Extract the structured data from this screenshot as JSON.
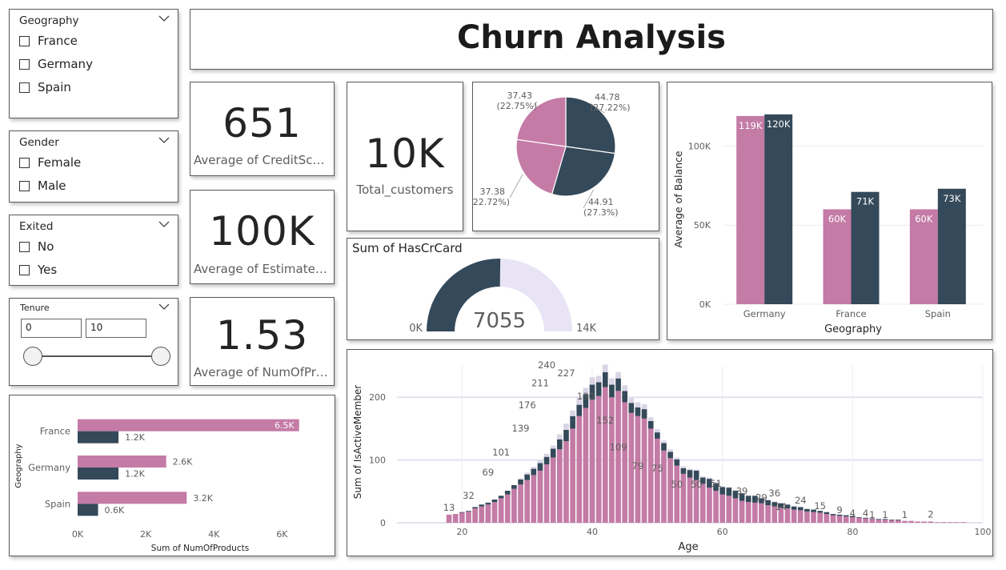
{
  "title": "Churn Analysis",
  "colors": {
    "pink": "#c47ba6",
    "navy": "#34495a",
    "light": "#e8e4f5",
    "grid": "#ececec"
  },
  "slicers": {
    "geography": {
      "title": "Geography",
      "options": [
        "France",
        "Germany",
        "Spain"
      ]
    },
    "gender": {
      "title": "Gender",
      "options": [
        "Female",
        "Male"
      ]
    },
    "exited": {
      "title": "Exited",
      "options": [
        "No",
        "Yes"
      ]
    },
    "tenure": {
      "title": "Tenure",
      "min": "0",
      "max": "10"
    }
  },
  "kpis": {
    "credit": {
      "value": "651",
      "label": "Average of CreditScore"
    },
    "salary": {
      "value": "100K",
      "label": "Average of Estimated..."
    },
    "products": {
      "value": "1.53",
      "label": "Average of NumOfPro..."
    },
    "customers": {
      "value": "10K",
      "label": "Total_customers"
    }
  },
  "gauge": {
    "title": "Sum of HasCrCard",
    "value_label": "7055",
    "min_label": "0K",
    "max_label": "14K",
    "value": 7055,
    "max": 14000
  },
  "chart_data": [
    {
      "type": "pie",
      "slices": [
        {
          "value": 44.78,
          "label": "44.78",
          "pct": "(27.22%)",
          "color": "navy"
        },
        {
          "value": 44.91,
          "label": "44.91",
          "pct": "(27.3%)",
          "color": "navy"
        },
        {
          "value": 37.38,
          "label": "37.38",
          "pct": "(22.72%)",
          "color": "pink"
        },
        {
          "value": 37.43,
          "label": "37.43",
          "pct": "(22.75%)",
          "color": "pink"
        }
      ]
    },
    {
      "type": "bar",
      "categories": [
        "Germany",
        "France",
        "Spain"
      ],
      "series": [
        {
          "values": [
            119000,
            60000,
            60000
          ],
          "labels": [
            "119K",
            "60K",
            "60K"
          ]
        },
        {
          "values": [
            120000,
            71000,
            73000
          ],
          "labels": [
            "120K",
            "71K",
            "73K"
          ]
        }
      ],
      "xlabel": "Geography",
      "ylabel": "Average of Balance",
      "yticks": [
        0,
        50000,
        100000
      ],
      "ytick_labels": [
        "0K",
        "50K",
        "100K"
      ],
      "ylim": [
        0,
        125000
      ]
    },
    {
      "type": "bar",
      "orientation": "horizontal",
      "categories": [
        "France",
        "Germany",
        "Spain"
      ],
      "series": [
        {
          "values": [
            6500,
            2600,
            3200
          ],
          "labels": [
            "6.5K",
            "2.6K",
            "3.2K"
          ]
        },
        {
          "values": [
            1200,
            1200,
            600
          ],
          "labels": [
            "1.2K",
            "1.2K",
            "0.6K"
          ]
        }
      ],
      "xlabel": "Sum of NumOfProducts",
      "ylabel": "Geography",
      "xticks": [
        0,
        2000,
        4000,
        6000
      ],
      "xtick_labels": [
        "0K",
        "2K",
        "4K",
        "6K"
      ],
      "xlim": [
        0,
        7000
      ]
    },
    {
      "type": "bar",
      "xlabel": "Age",
      "ylabel": "Sum of IsActiveMember",
      "xlim": [
        10,
        100
      ],
      "ylim": [
        0,
        250
      ],
      "xticks": [
        20,
        40,
        60,
        80,
        100
      ],
      "yticks": [
        0,
        100,
        200
      ],
      "pink": [
        13,
        14,
        16,
        18,
        23,
        26,
        29,
        33,
        39,
        45,
        54,
        61,
        68,
        76,
        83,
        93,
        104,
        117,
        130,
        150,
        170,
        183,
        196,
        202,
        216,
        200,
        210,
        192,
        175,
        170,
        166,
        150,
        134,
        115,
        103,
        91,
        78,
        72,
        68,
        62,
        56,
        51,
        45,
        43,
        39,
        35,
        33,
        32,
        31,
        28,
        26,
        24,
        23,
        21,
        20,
        18,
        17,
        16,
        14,
        12,
        11,
        10,
        9,
        8,
        7,
        6,
        5,
        5,
        4,
        4,
        3,
        3,
        2,
        2,
        2,
        1,
        1,
        1,
        1,
        1
      ],
      "navy": [
        0,
        0,
        1,
        1,
        2,
        3,
        3,
        4,
        4,
        6,
        6,
        8,
        9,
        10,
        12,
        12,
        14,
        16,
        18,
        20,
        18,
        22,
        24,
        22,
        24,
        20,
        20,
        18,
        16,
        14,
        15,
        12,
        10,
        12,
        10,
        10,
        9,
        12,
        15,
        10,
        14,
        12,
        12,
        13,
        12,
        12,
        10,
        11,
        8,
        8,
        7,
        7,
        6,
        5,
        5,
        4,
        4,
        3,
        3,
        2,
        2,
        2,
        2,
        1,
        1,
        1,
        1,
        1,
        1,
        1,
        0,
        0,
        0,
        0,
        0,
        0,
        0,
        0,
        0,
        0
      ],
      "light": [
        0,
        0,
        0,
        0,
        0,
        0,
        0,
        0,
        0,
        0,
        0,
        2,
        3,
        3,
        4,
        5,
        5,
        8,
        10,
        9,
        12,
        10,
        12,
        10,
        12,
        10,
        10,
        9,
        8,
        8,
        8,
        6,
        5,
        4,
        4,
        3,
        3,
        2,
        2,
        2,
        2,
        2,
        1,
        1,
        1,
        1,
        1,
        1,
        1,
        1,
        1,
        1,
        1,
        0,
        0,
        0,
        0,
        0,
        0,
        0,
        0,
        0,
        0,
        0,
        0,
        0,
        0,
        0,
        0,
        0,
        0,
        0,
        0,
        0,
        0,
        0,
        0,
        0,
        0,
        0
      ],
      "point_labels": [
        {
          "x": 18,
          "y": 13,
          "t": "13"
        },
        {
          "x": 21,
          "y": 32,
          "t": "32"
        },
        {
          "x": 24,
          "y": 69,
          "t": "69"
        },
        {
          "x": 26,
          "y": 101,
          "t": "101"
        },
        {
          "x": 29,
          "y": 139,
          "t": "139"
        },
        {
          "x": 30,
          "y": 176,
          "t": "176"
        },
        {
          "x": 32,
          "y": 211,
          "t": "211"
        },
        {
          "x": 33,
          "y": 240,
          "t": "240"
        },
        {
          "x": 36,
          "y": 227,
          "t": "227"
        },
        {
          "x": 39,
          "y": 190,
          "t": "190"
        },
        {
          "x": 42,
          "y": 152,
          "t": "152"
        },
        {
          "x": 44,
          "y": 109,
          "t": "109"
        },
        {
          "x": 47,
          "y": 79,
          "t": "79"
        },
        {
          "x": 50,
          "y": 75,
          "t": "75"
        },
        {
          "x": 53,
          "y": 50,
          "t": "50"
        },
        {
          "x": 56,
          "y": 50,
          "t": "50"
        },
        {
          "x": 59,
          "y": 51,
          "t": "51"
        },
        {
          "x": 63,
          "y": 39,
          "t": "39"
        },
        {
          "x": 66,
          "y": 29,
          "t": "29"
        },
        {
          "x": 68,
          "y": 36,
          "t": "36"
        },
        {
          "x": 69,
          "y": 14,
          "t": "14"
        },
        {
          "x": 72,
          "y": 24,
          "t": "24"
        },
        {
          "x": 75,
          "y": 15,
          "t": "15"
        },
        {
          "x": 78,
          "y": 9,
          "t": "9"
        },
        {
          "x": 80,
          "y": 4,
          "t": "4"
        },
        {
          "x": 82,
          "y": 4,
          "t": "4"
        },
        {
          "x": 83,
          "y": 1,
          "t": "1"
        },
        {
          "x": 85,
          "y": 1,
          "t": "1"
        },
        {
          "x": 88,
          "y": 1,
          "t": "1"
        },
        {
          "x": 92,
          "y": 2,
          "t": "2"
        }
      ]
    }
  ]
}
